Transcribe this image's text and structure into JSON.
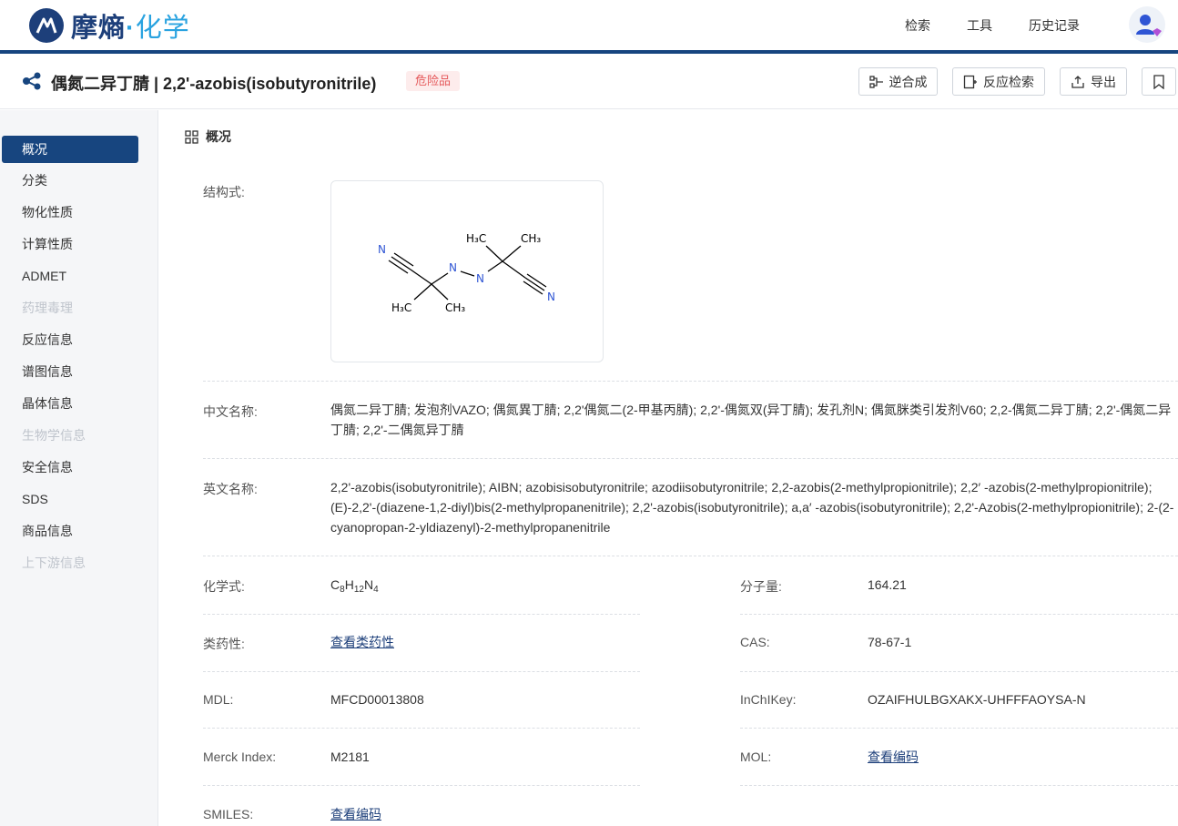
{
  "brand": {
    "name_main": "摩熵",
    "name_dot": "·",
    "name_sub": "化学"
  },
  "nav": {
    "search": "检索",
    "tools": "工具",
    "history": "历史记录"
  },
  "header": {
    "title": "偶氮二异丁腈 | 2,2'-azobis(isobutyronitrile)",
    "badge": "危险品",
    "btn_retro": "逆合成",
    "btn_reaction": "反应检索",
    "btn_export": "导出"
  },
  "sidebar": {
    "items": [
      {
        "label": "概况"
      },
      {
        "label": "分类"
      },
      {
        "label": "物化性质"
      },
      {
        "label": "计算性质"
      },
      {
        "label": "ADMET"
      },
      {
        "label": "药理毒理"
      },
      {
        "label": "反应信息"
      },
      {
        "label": "谱图信息"
      },
      {
        "label": "晶体信息"
      },
      {
        "label": "生物学信息"
      },
      {
        "label": "安全信息"
      },
      {
        "label": "SDS"
      },
      {
        "label": "商品信息"
      },
      {
        "label": "上下游信息"
      }
    ]
  },
  "overview": {
    "section_title": "概况",
    "structure_label": "结构式:",
    "structure_atoms": {
      "n": "N",
      "h3c": "H₃C",
      "ch3": "CH₃"
    },
    "cn_name_label": "中文名称:",
    "cn_name": "偶氮二异丁腈; 发泡剂VAZO; 偶氮異丁腈; 2,2'偶氮二(2-甲基丙腈); 2,2'-偶氮双(异丁腈); 发孔剂N; 偶氮脒类引发剂V60; 2,2-偶氮二异丁腈; 2,2'-偶氮二异丁腈; 2,2'-二偶氮异丁腈",
    "en_name_label": "英文名称:",
    "en_name": "2,2'-azobis(isobutyronitrile); AIBN; azobisisobutyronitrile; azodiisobutyronitrile; 2,2-azobis(2-methylpropionitrile); 2,2′ -azobis(2-methylpropionitrile); (E)-2,2'-(diazene-1,2-diyl)bis(2-methylpropanenitrile); 2,2'-azobis(isobutyronitrile); a,a′ -azobis(isobutyronitrile); 2,2'-Azobis(2-methylpropionitrile); 2-(2-cyanopropan-2-yldiazenyl)-2-methylpropanenitrile",
    "formula_label": "化学式:",
    "formula": {
      "c": "C",
      "c_n": "8",
      "h": "H",
      "h_n": "12",
      "n": "N",
      "n_n": "4"
    },
    "mw_label": "分子量:",
    "mw": "164.21",
    "druglike_label": "类药性:",
    "druglike_link": "查看类药性",
    "cas_label": "CAS:",
    "cas": "78-67-1",
    "mdl_label": "MDL:",
    "mdl": "MFCD00013808",
    "inchikey_label": "InChIKey:",
    "inchikey": "OZAIFHULBGXAKX-UHFFFAOYSA-N",
    "merck_label": "Merck Index:",
    "merck": "M2181",
    "mol_label": "MOL:",
    "mol_link": "查看编码",
    "smiles_label": "SMILES:",
    "smiles_link": "查看编码"
  },
  "colors": {
    "brand": "#1d3f7a",
    "accent": "#2aa3e0",
    "danger": "#e5595b",
    "nitrogen": "#2f55d4"
  }
}
